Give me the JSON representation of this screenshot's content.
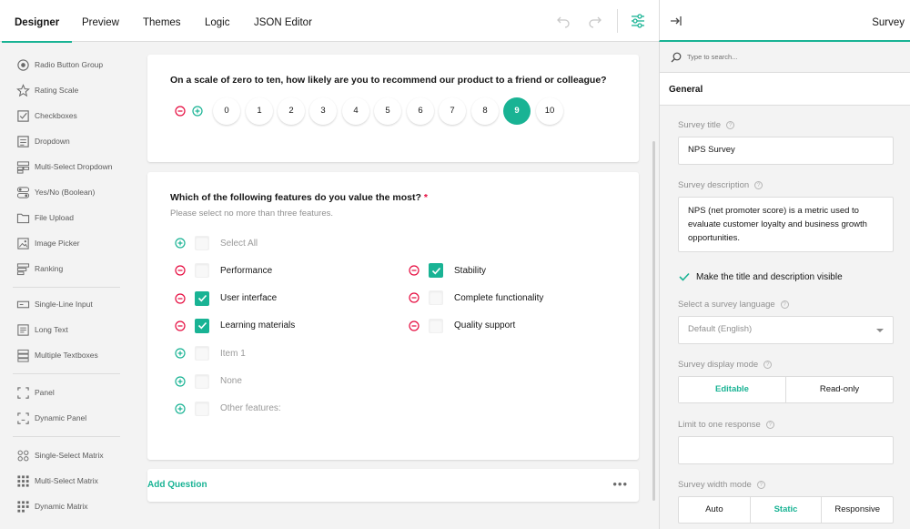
{
  "colors": {
    "accent": "#19b394",
    "remove": "#e60a3e",
    "required": "#e60a3e"
  },
  "tabs": [
    {
      "label": "Designer"
    },
    {
      "label": "Preview"
    },
    {
      "label": "Themes"
    },
    {
      "label": "Logic"
    },
    {
      "label": "JSON Editor"
    }
  ],
  "toolbox": {
    "items": [
      {
        "label": "Radio Button Group",
        "icon": "radio-icon"
      },
      {
        "label": "Rating Scale",
        "icon": "star-icon"
      },
      {
        "label": "Checkboxes",
        "icon": "checkbox-icon"
      },
      {
        "label": "Dropdown",
        "icon": "dropdown-icon"
      },
      {
        "label": "Multi-Select Dropdown",
        "icon": "tagbox-icon"
      },
      {
        "label": "Yes/No (Boolean)",
        "icon": "boolean-icon"
      },
      {
        "label": "File Upload",
        "icon": "folder-icon"
      },
      {
        "label": "Image Picker",
        "icon": "image-icon"
      },
      {
        "label": "Ranking",
        "icon": "ranking-icon"
      },
      {
        "label": "Single-Line Input",
        "icon": "text-input-icon"
      },
      {
        "label": "Long Text",
        "icon": "comment-icon"
      },
      {
        "label": "Multiple Textboxes",
        "icon": "multi-text-icon"
      },
      {
        "label": "Panel",
        "icon": "panel-icon"
      },
      {
        "label": "Dynamic Panel",
        "icon": "dynamic-panel-icon"
      },
      {
        "label": "Single-Select Matrix",
        "icon": "matrix-icon"
      },
      {
        "label": "Multi-Select Matrix",
        "icon": "matrix-dropdown-icon"
      },
      {
        "label": "Dynamic Matrix",
        "icon": "dynamic-matrix-icon"
      }
    ]
  },
  "q1": {
    "title": "On a scale of zero to ten, how likely are you to recommend our product to a friend or colleague?",
    "rates": [
      "0",
      "1",
      "2",
      "3",
      "4",
      "5",
      "6",
      "7",
      "8",
      "9",
      "10"
    ],
    "selected": "9"
  },
  "q2": {
    "title": "Which of the following features do you value the most?",
    "required_mark": "*",
    "description": "Please select no more than three features.",
    "left": [
      {
        "label": "Select All",
        "checked": false,
        "ghost": true,
        "action": "add"
      },
      {
        "label": "Performance",
        "checked": false,
        "ghost": false,
        "action": "remove"
      },
      {
        "label": "User interface",
        "checked": true,
        "ghost": false,
        "action": "remove"
      },
      {
        "label": "Learning materials",
        "checked": true,
        "ghost": false,
        "action": "remove"
      },
      {
        "label": "Item 1",
        "checked": false,
        "ghost": true,
        "action": "add"
      },
      {
        "label": "None",
        "checked": false,
        "ghost": true,
        "action": "add"
      },
      {
        "label": "Other features:",
        "checked": false,
        "ghost": true,
        "action": "add"
      }
    ],
    "right": [
      {
        "label": "Stability",
        "checked": true,
        "ghost": false,
        "action": "remove"
      },
      {
        "label": "Complete functionality",
        "checked": false,
        "ghost": false,
        "action": "remove"
      },
      {
        "label": "Quality support",
        "checked": false,
        "ghost": false,
        "action": "remove"
      }
    ]
  },
  "add_question": "Add Question",
  "more": "•••",
  "panel": {
    "title": "Survey",
    "search_placeholder": "Type to search...",
    "section": "General",
    "survey_title_label": "Survey title",
    "survey_title_value": "NPS Survey",
    "survey_desc_label": "Survey description",
    "survey_desc_value": "NPS (net promoter score) is a metric used to evaluate customer loyalty and business growth opportunities.",
    "visible_label": "Make the title and description visible",
    "visible_checked": true,
    "language_label": "Select a survey language",
    "language_value": "Default (English)",
    "display_mode_label": "Survey display mode",
    "display_modes": [
      "Editable",
      "Read-only"
    ],
    "display_mode_selected": "Editable",
    "limit_label": "Limit to one response",
    "width_mode_label": "Survey width mode",
    "width_modes": [
      "Auto",
      "Static",
      "Responsive"
    ],
    "width_mode_selected": "Static",
    "help_glyph": "?"
  }
}
